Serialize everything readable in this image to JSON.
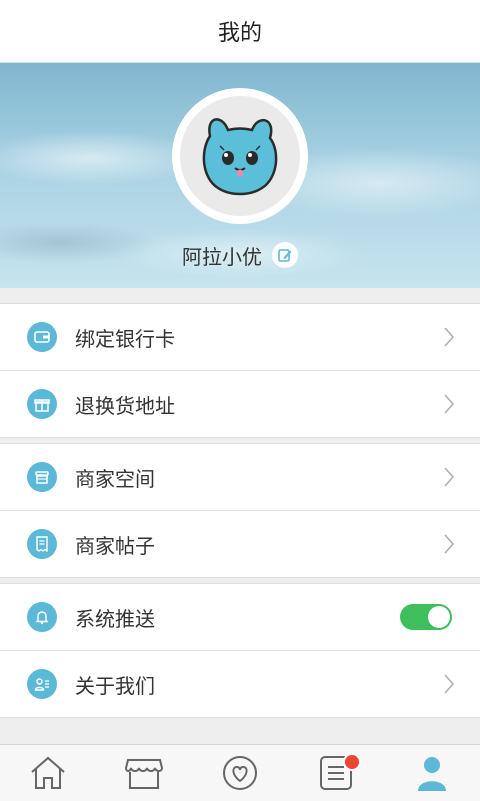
{
  "header": {
    "title": "我的"
  },
  "profile": {
    "username": "阿拉小优",
    "avatar": "rabbit-mascot-avatar"
  },
  "menu_groups": [
    {
      "items": [
        {
          "label": "绑定银行卡",
          "icon": "wallet-icon"
        },
        {
          "label": "退换货地址",
          "icon": "gift-icon"
        }
      ]
    },
    {
      "items": [
        {
          "label": "商家空间",
          "icon": "store-icon"
        },
        {
          "label": "商家帖子",
          "icon": "receipt-icon"
        }
      ]
    },
    {
      "items": [
        {
          "label": "系统推送",
          "icon": "bell-icon",
          "toggle": true
        },
        {
          "label": "关于我们",
          "icon": "contact-card-icon"
        }
      ]
    }
  ],
  "bottom_nav": [
    {
      "icon": "home-icon",
      "active": false
    },
    {
      "icon": "shop-icon",
      "active": false
    },
    {
      "icon": "heart-icon",
      "active": false
    },
    {
      "icon": "list-icon",
      "active": false,
      "badge": true
    },
    {
      "icon": "user-icon",
      "active": true
    }
  ],
  "colors": {
    "accent": "#5bb8d7",
    "toggle_on": "#3fbf5c",
    "badge": "#ee4433"
  }
}
